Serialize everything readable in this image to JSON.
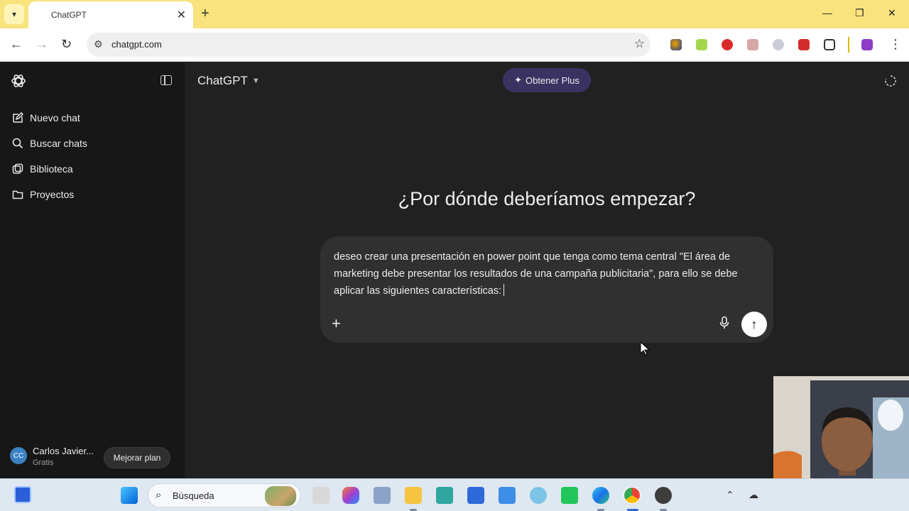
{
  "browser": {
    "tab_title": "ChatGPT",
    "url": "chatgpt.com"
  },
  "sidebar": {
    "items": [
      {
        "label": "Nuevo chat",
        "icon": "compose-icon"
      },
      {
        "label": "Buscar chats",
        "icon": "search-icon"
      },
      {
        "label": "Biblioteca",
        "icon": "library-icon"
      },
      {
        "label": "Proyectos",
        "icon": "folder-icon"
      }
    ],
    "user": {
      "initials": "CC",
      "name": "Carlos Javier...",
      "plan": "Gratis"
    },
    "upgrade_label": "Mejorar plan"
  },
  "header": {
    "model_name": "ChatGPT",
    "plus_label": "Obtener Plus"
  },
  "main": {
    "headline": "¿Por dónde deberíamos empezar?",
    "composer_text": "deseo crear una presentación en power point que tenga como tema central \"El área de marketing debe presentar los resultados de una campaña publicitaria\", para ello se debe aplicar las siguientes características:"
  },
  "taskbar": {
    "search_label": "Búsqueda"
  },
  "colors": {
    "sidebar_bg": "#171717",
    "main_bg": "#212121",
    "composer_bg": "#303030",
    "plus_button_bg": "#3a3362",
    "tabstrip_bg": "#f9e37c"
  }
}
